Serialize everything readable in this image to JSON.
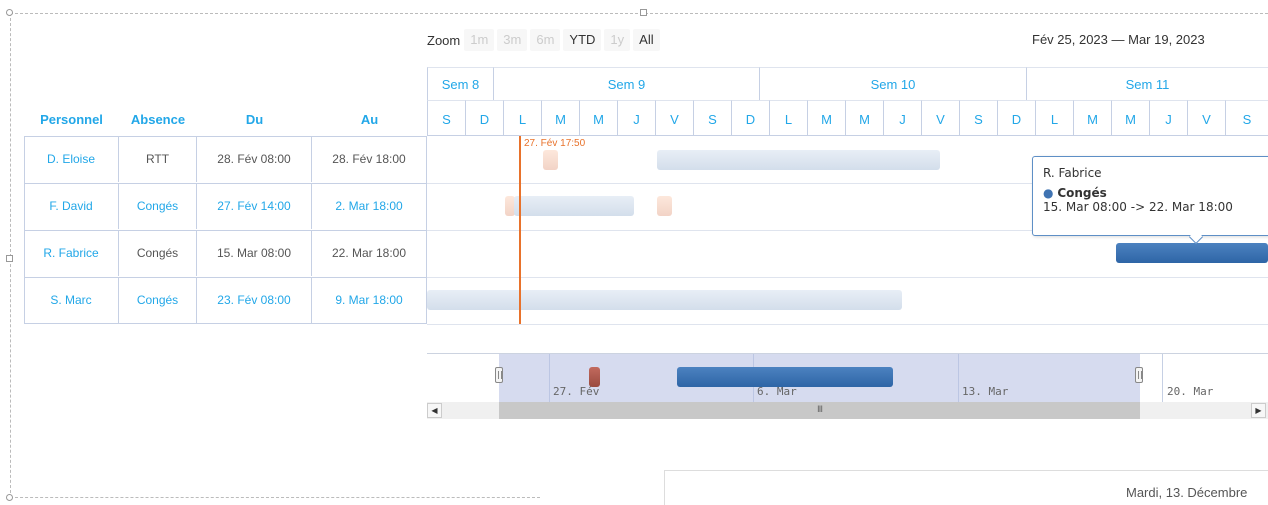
{
  "toolbar": {
    "zoom_label": "Zoom",
    "buttons": [
      "1m",
      "3m",
      "6m",
      "YTD",
      "1y",
      "All"
    ],
    "range": "Fév 25, 2023  —  Mar 19, 2023"
  },
  "columns": [
    "Personnel",
    "Absence",
    "Du",
    "Au"
  ],
  "rows": [
    {
      "personnel": "D. Eloise",
      "absence": "RTT",
      "du": "28. Fév 08:00",
      "au": "28. Fév 18:00"
    },
    {
      "personnel": "F. David",
      "absence": "Congés",
      "du": "27. Fév 14:00",
      "au": "2. Mar 18:00"
    },
    {
      "personnel": "R. Fabrice",
      "absence": "Congés",
      "du": "15. Mar 08:00",
      "au": "22. Mar 18:00"
    },
    {
      "personnel": "S. Marc",
      "absence": "Congés",
      "du": "23. Fév 08:00",
      "au": "9. Mar 18:00"
    }
  ],
  "weeks": [
    "Sem 8",
    "Sem 9",
    "Sem 10",
    "Sem 11"
  ],
  "days": [
    "S",
    "D",
    "L",
    "M",
    "M",
    "J",
    "V",
    "S",
    "D",
    "L",
    "M",
    "M",
    "J",
    "V",
    "S",
    "D",
    "L",
    "M",
    "M",
    "J",
    "V",
    "S"
  ],
  "today_label": "27. Fév 17:50",
  "tooltip": {
    "name": "R. Fabrice",
    "type": "Congés",
    "range": "15. Mar 08:00 -> 22. Mar 18:00"
  },
  "navigator": {
    "labels": [
      "27. Fév",
      "6. Mar",
      "13. Mar",
      "20. Mar"
    ],
    "scroll_grip": "III"
  },
  "calendar": {
    "date": "Mardi, 13. Décembre"
  },
  "colors": {
    "accent": "#22a7e8",
    "today": "#e8722b",
    "selected_bar": "#2e65a6"
  }
}
